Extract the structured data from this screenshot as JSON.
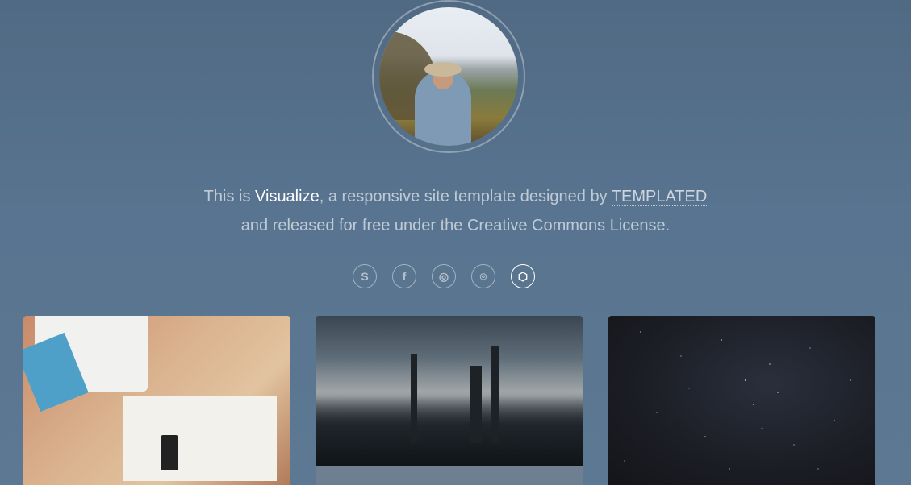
{
  "intro": {
    "prefix": "This is ",
    "brand": "Visualize",
    "middle": ", a responsive site template designed by ",
    "designer": "TEMPLATED",
    "line2": "and released for free under the Creative Commons License."
  },
  "social": [
    {
      "icon": "skype-icon",
      "glyph": "S"
    },
    {
      "icon": "facebook-icon",
      "glyph": "f"
    },
    {
      "icon": "instagram-icon",
      "glyph": "◎"
    },
    {
      "icon": "github-icon",
      "glyph": "⌾"
    },
    {
      "icon": "codepen-icon",
      "glyph": "⬡"
    }
  ],
  "gallery": [
    {
      "name": "gallery-image-desk"
    },
    {
      "name": "gallery-image-city-skyline"
    },
    {
      "name": "gallery-image-night-sky"
    }
  ]
}
